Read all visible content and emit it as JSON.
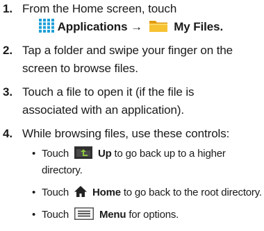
{
  "steps": [
    {
      "num": "1.",
      "line1": "From the Home screen, touch",
      "apps_label": "Applications",
      "arrow": "→",
      "files_label": "My Files",
      "end": "."
    },
    {
      "num": "2.",
      "text": "Tap a folder and swipe your finger on the screen to browse files."
    },
    {
      "num": "3.",
      "text": "Touch a file to open it (if the file is associated with an application)."
    },
    {
      "num": "4.",
      "text": "While browsing files, use these controls:",
      "controls": [
        {
          "bullet": "•",
          "touch": "Touch",
          "icon": "folder-up-icon",
          "label": "Up",
          "desc": "to go back up to a higher directory."
        },
        {
          "bullet": "•",
          "touch": "Touch",
          "icon": "home-icon",
          "label": "Home",
          "desc": "to go back to the root directory."
        },
        {
          "bullet": "•",
          "touch": "Touch",
          "icon": "menu-icon",
          "label": "Menu",
          "desc": "for options."
        }
      ]
    }
  ],
  "colors": {
    "applications_icon": "#1e9fd8",
    "folder_icon": "#f2b21c",
    "up_icon_bg": "#3a3a3a",
    "up_icon_arrow": "#8cc63f",
    "home_icon": "#222222",
    "menu_icon": "#555555"
  }
}
